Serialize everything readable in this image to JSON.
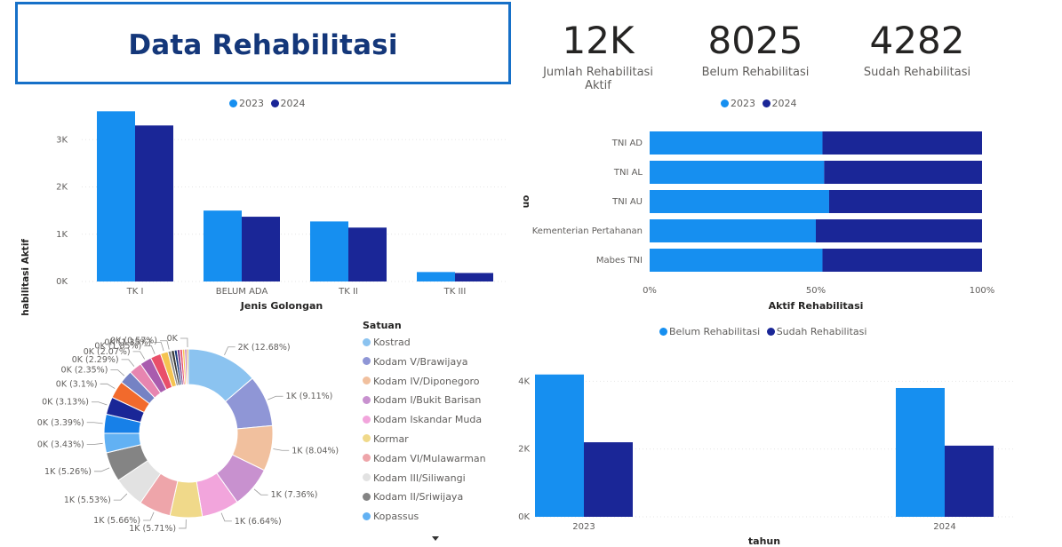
{
  "header": {
    "title": "Data Rehabilitasi"
  },
  "kpis": [
    {
      "value": "12K",
      "label": "Jumlah Rehabilitasi Aktif"
    },
    {
      "value": "8025",
      "label": "Belum Rehabilitasi"
    },
    {
      "value": "4282",
      "label": "Sudah Rehabilitasi"
    }
  ],
  "colors": {
    "light": "#168ff0",
    "dark": "#1a2697",
    "title": "#14377a",
    "border": "#1670c8"
  },
  "icons": {
    "dropdown": "caret-down-icon"
  },
  "chart_data": [
    {
      "id": "golongan",
      "type": "bar",
      "xlabel": "Jenis Golongan",
      "ylabel": "Rehabilitasi Aktif",
      "categories": [
        "TK I",
        "BELUM ADA",
        "TK II",
        "TK III"
      ],
      "series": [
        {
          "name": "2023",
          "color": "#168ff0",
          "values": [
            3600,
            1500,
            1270,
            200
          ]
        },
        {
          "name": "2024",
          "color": "#1a2697",
          "values": [
            3300,
            1370,
            1140,
            180
          ]
        }
      ],
      "yticks": [
        "0K",
        "1K",
        "2K",
        "3K"
      ],
      "ylim": [
        0,
        3700
      ],
      "legend": "top-center"
    },
    {
      "id": "uo",
      "type": "bar",
      "orientation": "horizontal-100pct-stacked",
      "xlabel": "Aktif Rehabilitasi",
      "ylabel": "uo",
      "categories": [
        "TNI AD",
        "TNI AL",
        "TNI AU",
        "Kementerian Pertahanan",
        "Mabes TNI"
      ],
      "series": [
        {
          "name": "2023",
          "color": "#168ff0",
          "values": [
            52,
            52.5,
            54,
            50,
            52
          ]
        },
        {
          "name": "2024",
          "color": "#1a2697",
          "values": [
            48,
            47.5,
            46,
            50,
            48
          ]
        }
      ],
      "xticks": [
        "0%",
        "50%",
        "100%"
      ],
      "legend": "top-center"
    },
    {
      "id": "satuan",
      "type": "pie",
      "variant": "donut",
      "legend_title": "Satuan",
      "legend_items": [
        {
          "name": "Kostrad",
          "color": "#8bc3f0"
        },
        {
          "name": "Kodam V/Brawijaya",
          "color": "#8f96d6"
        },
        {
          "name": "Kodam IV/Diponegoro",
          "color": "#f1c09e"
        },
        {
          "name": "Kodam I/Bukit Barisan",
          "color": "#c891cf"
        },
        {
          "name": "Kodam Iskandar Muda",
          "color": "#f2a5dc"
        },
        {
          "name": "Kormar",
          "color": "#f0d98a"
        },
        {
          "name": "Kodam VI/Mulawarman",
          "color": "#eea5aa"
        },
        {
          "name": "Kodam III/Siliwangi",
          "color": "#e2e2e2"
        },
        {
          "name": "Kodam II/Sriwijaya",
          "color": "#848484"
        },
        {
          "name": "Kopassus",
          "color": "#62b1f3"
        }
      ],
      "slices": [
        {
          "label": "2K (12.68%)",
          "value": 12.68,
          "color": "#8bc3f0"
        },
        {
          "label": "1K (9.11%)",
          "value": 9.11,
          "color": "#8f96d6"
        },
        {
          "label": "1K (8.04%)",
          "value": 8.04,
          "color": "#f1c09e"
        },
        {
          "label": "1K (7.36%)",
          "value": 7.36,
          "color": "#c891cf"
        },
        {
          "label": "1K (6.64%)",
          "value": 6.64,
          "color": "#f2a5dc"
        },
        {
          "label": "1K (5.71%)",
          "value": 5.71,
          "color": "#f0d98a"
        },
        {
          "label": "1K (5.66%)",
          "value": 5.66,
          "color": "#eea5aa"
        },
        {
          "label": "1K (5.53%)",
          "value": 5.53,
          "color": "#e2e2e2"
        },
        {
          "label": "1K (5.26%)",
          "value": 5.26,
          "color": "#848484"
        },
        {
          "label": "0K (3.43%)",
          "value": 3.43,
          "color": "#62b1f3"
        },
        {
          "label": "0K (3.39%)",
          "value": 3.39,
          "color": "#1780e8"
        },
        {
          "label": "0K (3.13%)",
          "value": 3.13,
          "color": "#1a2697"
        },
        {
          "label": "0K (3.1%)",
          "value": 3.1,
          "color": "#f26a2c"
        },
        {
          "label": "0K (2.35%)",
          "value": 2.35,
          "color": "#7582c4"
        },
        {
          "label": "0K (2.29%)",
          "value": 2.29,
          "color": "#e785b0"
        },
        {
          "label": "0K (2.07%)",
          "value": 2.07,
          "color": "#a95cae"
        },
        {
          "label": "0K (1.85%)",
          "value": 1.85,
          "color": "#e94f6a"
        },
        {
          "label": "0K (1.35%)",
          "value": 1.35,
          "color": "#f5c451"
        },
        {
          "label": "0K (0.57%)",
          "value": 0.57,
          "color": "#8b8b8b"
        },
        {
          "label": "",
          "value": 0.55,
          "color": "#3a3a3a"
        },
        {
          "label": "",
          "value": 0.5,
          "color": "#14377a"
        },
        {
          "label": "",
          "value": 0.5,
          "color": "#7c3a8c"
        },
        {
          "label": "",
          "value": 0.45,
          "color": "#e94f6a"
        },
        {
          "label": "",
          "value": 0.4,
          "color": "#f5c451"
        },
        {
          "label": "",
          "value": 0.35,
          "color": "#b75aa8"
        },
        {
          "label": "0K",
          "value": 0.3,
          "color": "#d9a33a"
        }
      ]
    },
    {
      "id": "tahun",
      "type": "bar",
      "xlabel": "tahun",
      "ylabel": "",
      "categories": [
        "2023",
        "2024"
      ],
      "series": [
        {
          "name": "Belum Rehabilitasi",
          "color": "#168ff0",
          "values": [
            4200,
            3800
          ]
        },
        {
          "name": "Sudah Rehabilitasi",
          "color": "#1a2697",
          "values": [
            2200,
            2100
          ]
        }
      ],
      "yticks": [
        "0K",
        "2K",
        "4K"
      ],
      "ylim": [
        0,
        4350
      ],
      "legend": "top-center"
    }
  ]
}
